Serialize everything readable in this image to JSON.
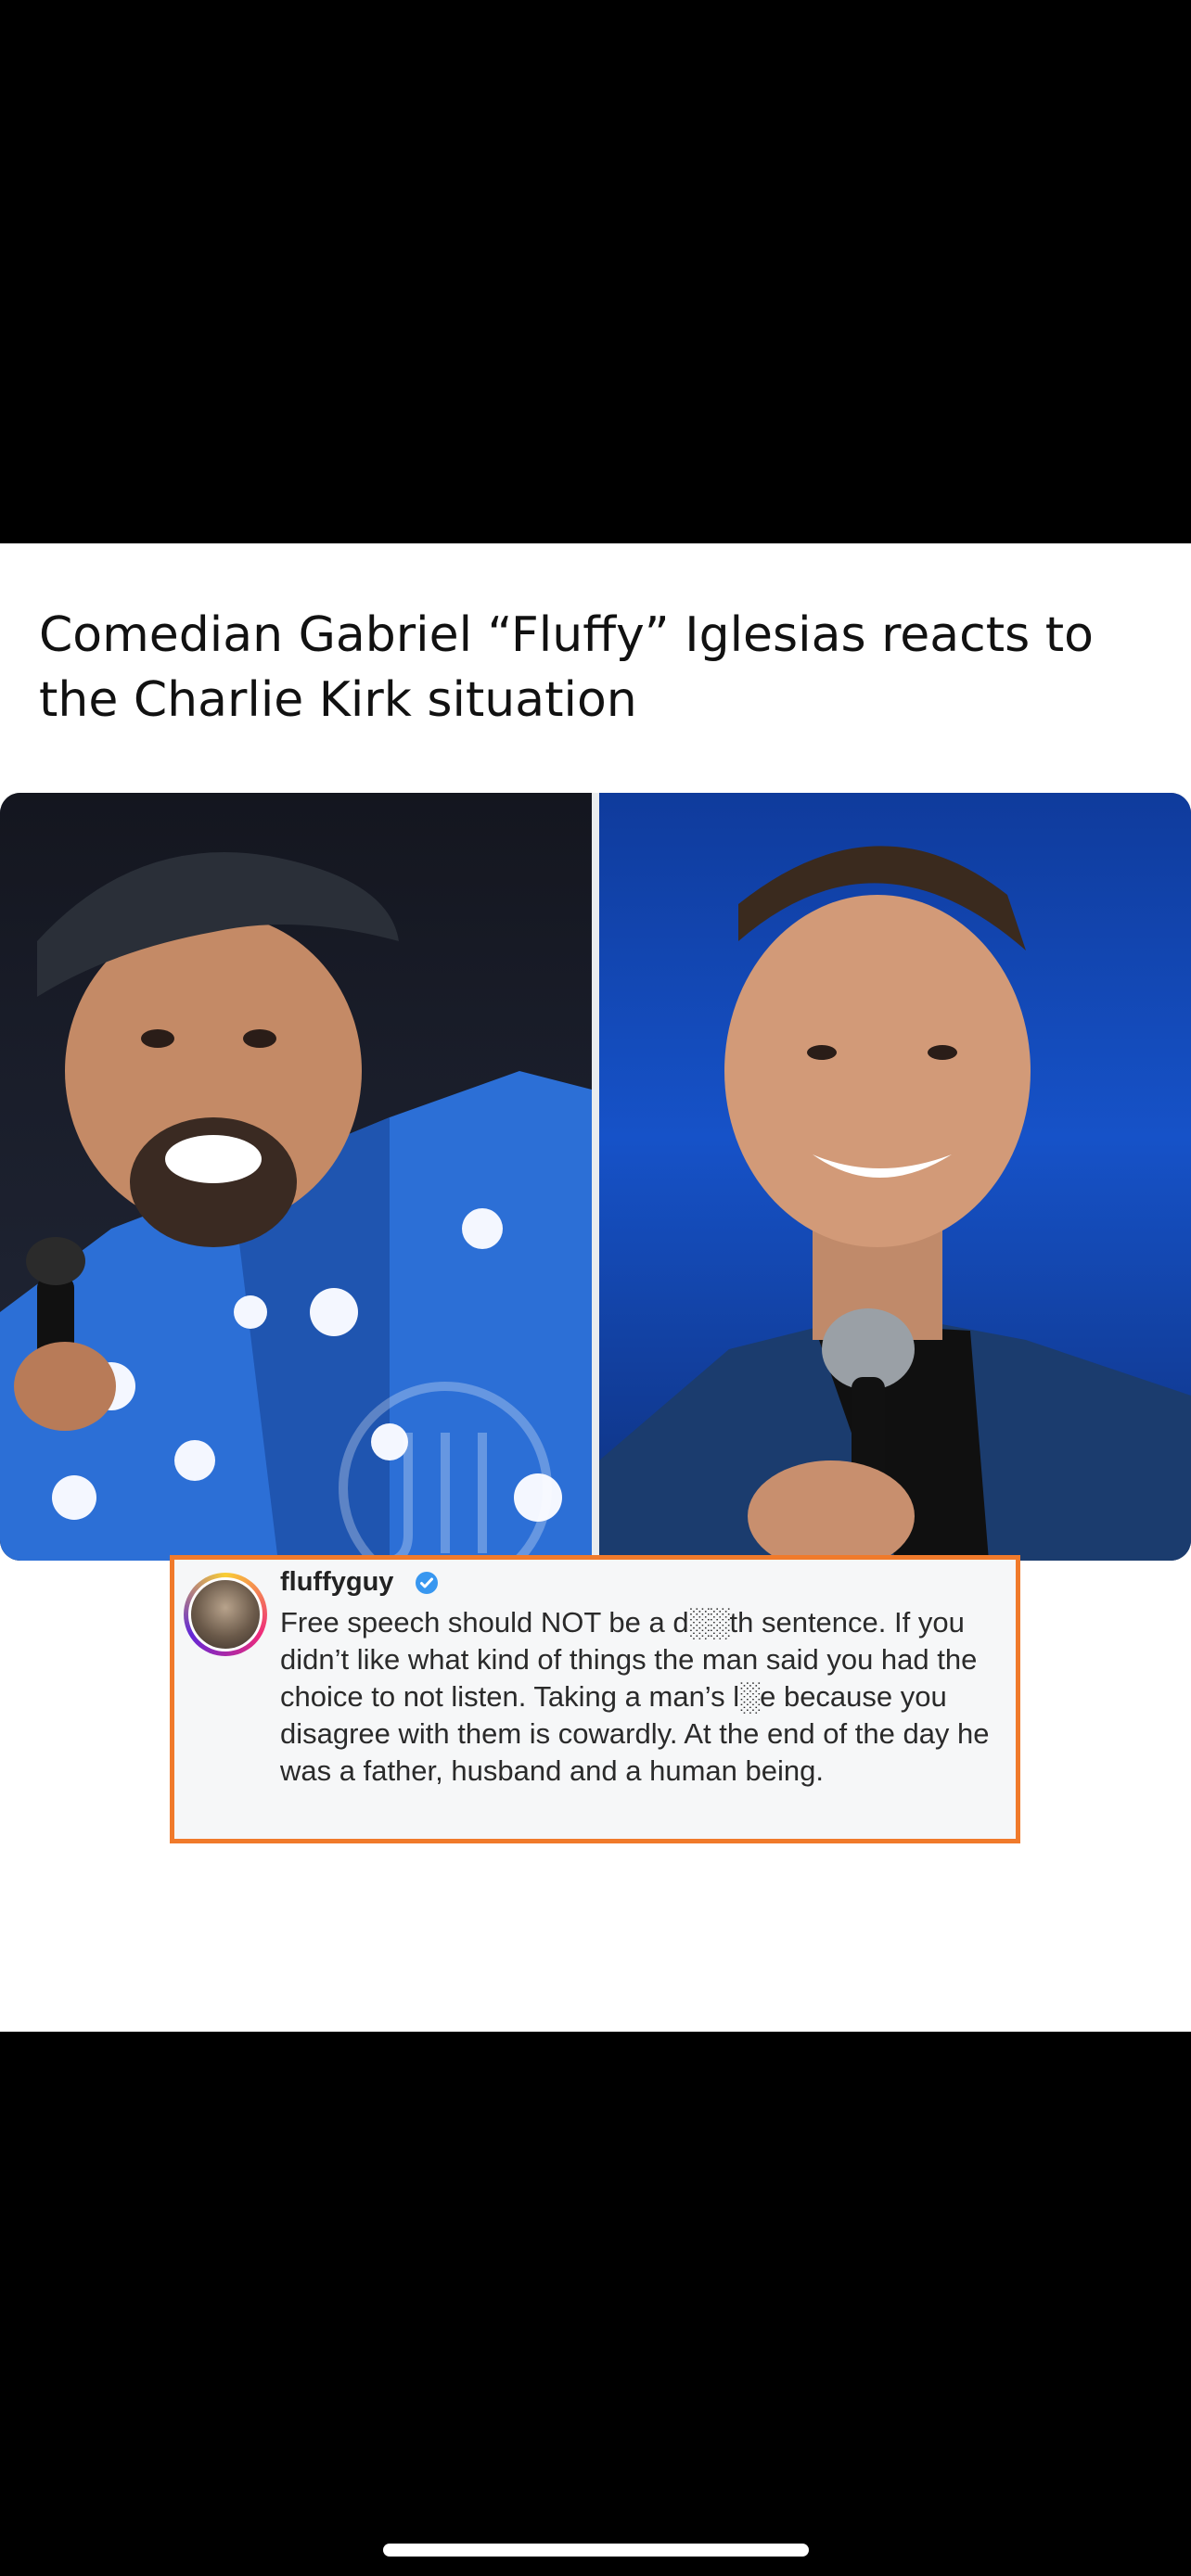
{
  "post": {
    "headline": "Comedian Gabriel “Fluffy” Iglesias reacts to the Charlie Kirk situation"
  },
  "comment": {
    "username": "fluffyguy",
    "text": "Free speech should NOT be a d░░th sentence. If you didn’t like what kind of things the man said you had the choice to not listen. Taking a man’s l░e because you disagree with them is cowardly. At the end of the day he was a father, husband and a human being."
  },
  "icons": {
    "verified": "verified-badge-icon",
    "avatar": "profile-avatar"
  },
  "colors": {
    "comment_border": "#f07a2b",
    "verified_blue": "#3897f0",
    "left_background": "#1a1e2b",
    "right_background": "#1652c8"
  }
}
